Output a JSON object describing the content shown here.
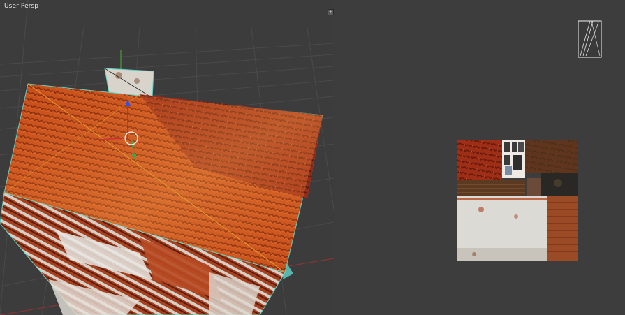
{
  "viewport3d": {
    "label": "User Persp",
    "colors": {
      "background": "#3c3c3c",
      "grid": "#4a4a4a",
      "x_axis": "#a83a3a",
      "y_axis": "#4e9a3a",
      "selection_edge": "#e39b2b",
      "face_outline": "#5fd3c7"
    }
  },
  "uv_editor": {
    "colors": {
      "background": "#3d3d3d"
    }
  },
  "icons": {
    "split_left": "split-corner-icon",
    "split_right": "split-corner-icon",
    "transform_gizmo": "transform-gizmo-icon",
    "uv_island": "uv-island-icon"
  },
  "split_glyph": "+"
}
